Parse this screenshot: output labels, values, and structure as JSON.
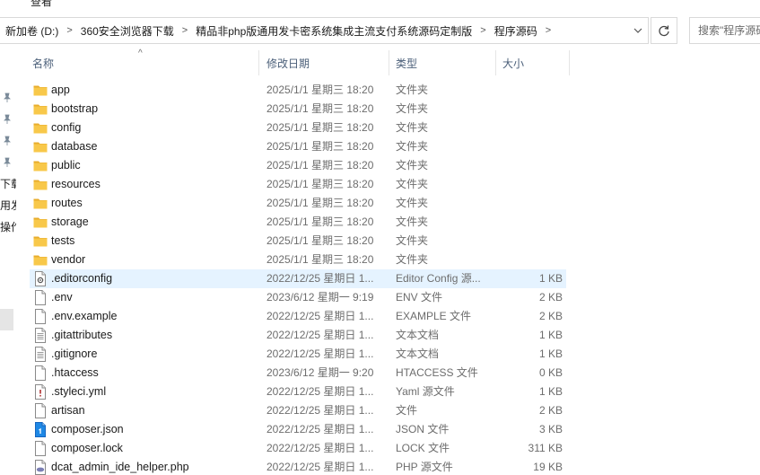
{
  "menu": {
    "view_label": "查看"
  },
  "address": {
    "crumbs": [
      "新加卷 (D:)",
      "360安全浏览器下载",
      "精品非php版通用发卡密系统集成主流支付系统源码定制版",
      "程序源码"
    ]
  },
  "search": {
    "placeholder": "搜索\"程序源码\""
  },
  "nav": {
    "fragments": [
      "下载",
      "用发",
      "操作"
    ]
  },
  "columns": {
    "name": "名称",
    "date": "修改日期",
    "type": "类型",
    "size": "大小"
  },
  "files": [
    {
      "name": "app",
      "date": "2025/1/1 星期三 18:20",
      "type": "文件夹",
      "size": "",
      "icon": "folder-icon"
    },
    {
      "name": "bootstrap",
      "date": "2025/1/1 星期三 18:20",
      "type": "文件夹",
      "size": "",
      "icon": "folder-icon"
    },
    {
      "name": "config",
      "date": "2025/1/1 星期三 18:20",
      "type": "文件夹",
      "size": "",
      "icon": "folder-icon"
    },
    {
      "name": "database",
      "date": "2025/1/1 星期三 18:20",
      "type": "文件夹",
      "size": "",
      "icon": "folder-icon"
    },
    {
      "name": "public",
      "date": "2025/1/1 星期三 18:20",
      "type": "文件夹",
      "size": "",
      "icon": "folder-icon"
    },
    {
      "name": "resources",
      "date": "2025/1/1 星期三 18:20",
      "type": "文件夹",
      "size": "",
      "icon": "folder-icon"
    },
    {
      "name": "routes",
      "date": "2025/1/1 星期三 18:20",
      "type": "文件夹",
      "size": "",
      "icon": "folder-icon"
    },
    {
      "name": "storage",
      "date": "2025/1/1 星期三 18:20",
      "type": "文件夹",
      "size": "",
      "icon": "folder-icon"
    },
    {
      "name": "tests",
      "date": "2025/1/1 星期三 18:20",
      "type": "文件夹",
      "size": "",
      "icon": "folder-icon"
    },
    {
      "name": "vendor",
      "date": "2025/1/1 星期三 18:20",
      "type": "文件夹",
      "size": "",
      "icon": "folder-icon"
    },
    {
      "name": ".editorconfig",
      "date": "2022/12/25 星期日 1...",
      "type": "Editor Config 源...",
      "size": "1 KB",
      "icon": "config-file-icon",
      "hovered": true
    },
    {
      "name": ".env",
      "date": "2023/6/12 星期一 9:19",
      "type": "ENV 文件",
      "size": "2 KB",
      "icon": "blank-file-icon"
    },
    {
      "name": ".env.example",
      "date": "2022/12/25 星期日 1...",
      "type": "EXAMPLE 文件",
      "size": "2 KB",
      "icon": "blank-file-icon"
    },
    {
      "name": ".gitattributes",
      "date": "2022/12/25 星期日 1...",
      "type": "文本文档",
      "size": "1 KB",
      "icon": "text-file-icon"
    },
    {
      "name": ".gitignore",
      "date": "2022/12/25 星期日 1...",
      "type": "文本文档",
      "size": "1 KB",
      "icon": "text-file-icon"
    },
    {
      "name": ".htaccess",
      "date": "2023/6/12 星期一 9:20",
      "type": "HTACCESS 文件",
      "size": "0 KB",
      "icon": "blank-file-icon"
    },
    {
      "name": ".styleci.yml",
      "date": "2022/12/25 星期日 1...",
      "type": "Yaml 源文件",
      "size": "1 KB",
      "icon": "yaml-file-icon"
    },
    {
      "name": "artisan",
      "date": "2022/12/25 星期日 1...",
      "type": "文件",
      "size": "2 KB",
      "icon": "blank-file-icon"
    },
    {
      "name": "composer.json",
      "date": "2022/12/25 星期日 1...",
      "type": "JSON 文件",
      "size": "3 KB",
      "icon": "json-file-icon"
    },
    {
      "name": "composer.lock",
      "date": "2022/12/25 星期日 1...",
      "type": "LOCK 文件",
      "size": "311 KB",
      "icon": "blank-file-icon"
    },
    {
      "name": "dcat_admin_ide_helper.php",
      "date": "2022/12/25 星期日 1...",
      "type": "PHP 源文件",
      "size": "19 KB",
      "icon": "php-file-icon"
    }
  ],
  "colors": {
    "folder": "#f8c84a",
    "hover": "#e5f3ff",
    "header_text": "#4c607a",
    "json_icon": "#1e88e5"
  }
}
